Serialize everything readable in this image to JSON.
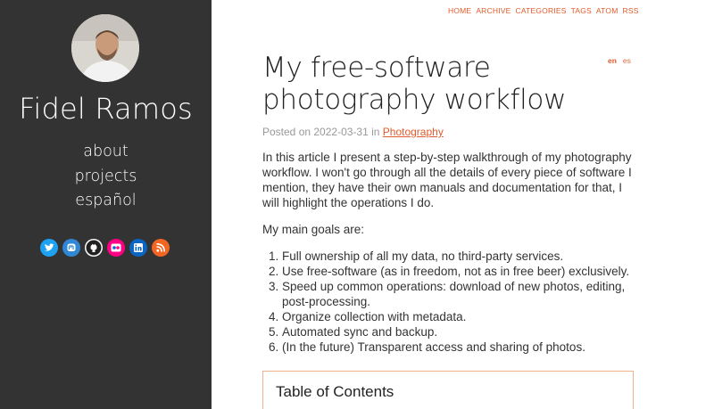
{
  "sidebar": {
    "name": "Fidel Ramos",
    "links": [
      "about",
      "projects",
      "español"
    ],
    "social_icons": [
      "twitter-icon",
      "mastodon-icon",
      "github-icon",
      "flickr-icon",
      "linkedin-icon",
      "rss-icon"
    ]
  },
  "topnav": [
    "HOME",
    "ARCHIVE",
    "CATEGORIES",
    "TAGS",
    "ATOM",
    "RSS"
  ],
  "lang": {
    "current": "en",
    "other": "es"
  },
  "post": {
    "title": "My free-software photography workflow",
    "meta_prefix": "Posted on 2022-03-31 in ",
    "category": "Photography",
    "intro": "In this article I present a step-by-step walkthrough of my photography workflow. I won't go through all the details of every piece of software I mention, they have their own manuals and documentation for that, I will highlight the operations I do.",
    "goals_heading": "My main goals are:",
    "goals": [
      "Full ownership of all my data, no third-party services.",
      "Use free-software (as in freedom, not as in free beer) exclusively.",
      "Speed up common operations: download of new photos, editing, post-processing.",
      "Organize collection with metadata.",
      "Automated sync and backup.",
      "(In the future) Transparent access and sharing of photos."
    ],
    "toc_title": "Table of Contents"
  },
  "colors": {
    "sidebar": "#333333",
    "accent": "#e05a2b"
  }
}
